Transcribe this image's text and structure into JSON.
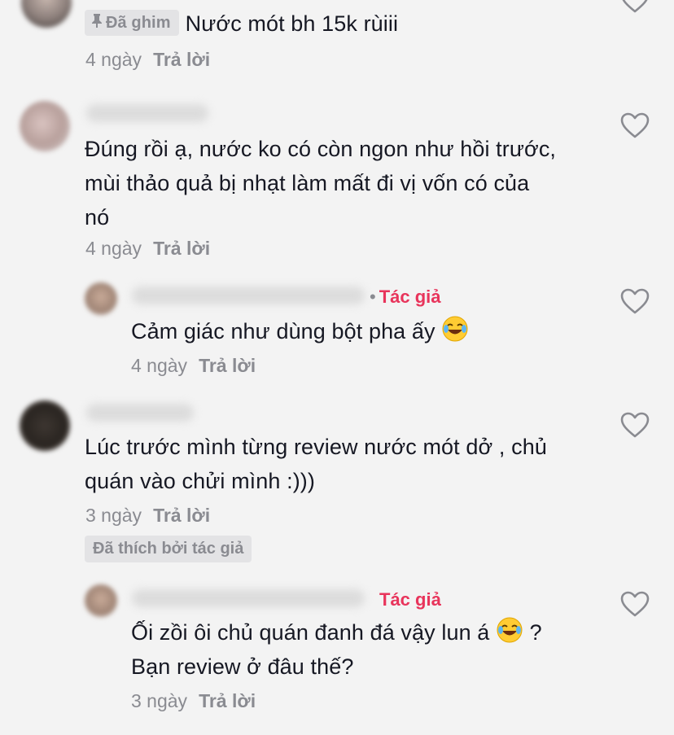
{
  "comments": [
    {
      "pinned_label": "Đã ghim",
      "text": "Nước mót bh 15k rùiii",
      "time": "4 ngày",
      "reply_label": "Trả lời"
    },
    {
      "text_lines": [
        "Đúng rồi ạ, nước ko có còn ngon như hồi trước,",
        "mùi thảo quả bị nhạt làm mất đi vị vốn có của",
        "nó"
      ],
      "time": "4 ngày",
      "reply_label": "Trả lời"
    },
    {
      "author_label": "Tác giả",
      "text": "Cảm giác như dùng bột pha ấy",
      "time": "4 ngày",
      "reply_label": "Trả lời"
    },
    {
      "text_lines": [
        "Lúc trước mình từng review nước mót dở , chủ",
        "quán vào chửi mình :)))"
      ],
      "time": "3 ngày",
      "reply_label": "Trả lời",
      "liked_by_author_label": "Đã thích bởi tác giả"
    },
    {
      "author_label": "Tác giả",
      "text_line1": "Ối zồi ôi chủ quán đanh đá vậy lun á",
      "text_line1_suffix": " ?",
      "text_line2": "Bạn review ở đâu thế?",
      "time": "3 ngày",
      "reply_label": "Trả lời"
    }
  ],
  "colors": {
    "background": "#f3f3f3",
    "text": "#161823",
    "meta": "#8a8b91",
    "author_tag": "#e8345b",
    "badge_bg": "#e3e3e5"
  },
  "icons": {
    "like": "heart-outline-icon",
    "pin": "pin-icon",
    "emoji": "tears-of-joy-emoji"
  }
}
